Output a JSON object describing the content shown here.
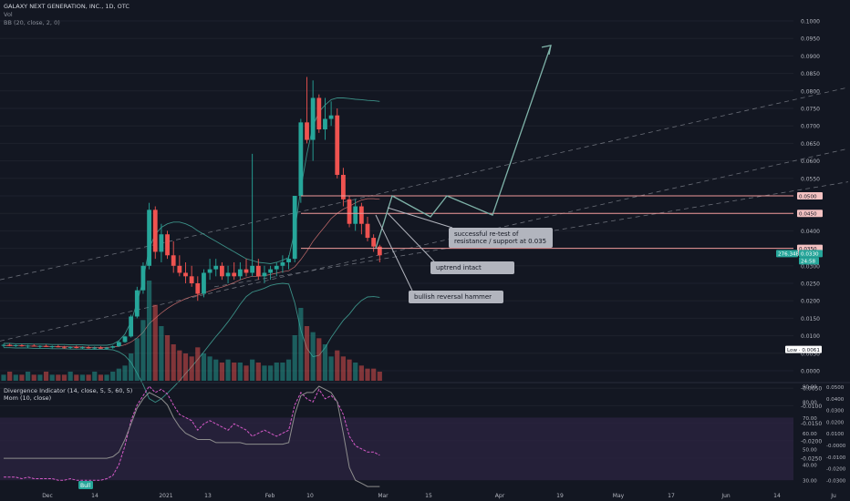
{
  "header": {
    "title": "GALAXY NEXT GENERATION, INC., 1D, OTC",
    "vol_label": "Vol",
    "bb_label": "BB (20, close, 2, 0)",
    "div_label": "Divergence Indicator (14, close, 5, 5, 60, 5)",
    "mom_label": "Mom (10, close)"
  },
  "colors": {
    "background": "#131722",
    "up": "#26a69a",
    "down": "#ef5350",
    "grid": "#1e222d",
    "text": "#b2b5be",
    "hline": "#ef9a9a",
    "projection": "#7fb3a9",
    "rsi_band": "#2b2340",
    "rsi": "#d459c7",
    "mom": "#8d8d8d",
    "label_bg": "#b2b5be"
  },
  "chart_data": {
    "type": "candlestick",
    "title": "GALAXY NEXT GENERATION, INC., 1D, OTC",
    "y_ticks": [
      "0.1000",
      "0.0950",
      "0.0900",
      "0.0850",
      "0.0800",
      "0.0750",
      "0.0700",
      "0.0650",
      "0.0600",
      "0.0550",
      "0.0500",
      "0.0450",
      "0.0400",
      "0.0350",
      "0.0300",
      "0.0250",
      "0.0200",
      "0.0150",
      "0.0100",
      "0.0050",
      "0.0000",
      "-0.0050",
      "-0.0100",
      "-0.0150",
      "-0.0200",
      "-0.0250"
    ],
    "x_ticks": [
      "Dec",
      "14",
      "2021",
      "13",
      "Feb",
      "10",
      "Mar",
      "15",
      "Apr",
      "19",
      "May",
      "17",
      "Jun",
      "14",
      "Ju"
    ],
    "price_labels": {
      "r050": "0.0500",
      "r045": "0.0450",
      "r035": "0.0350",
      "vol": "276.34B",
      "last": "0.0330",
      "countdown": "24:58",
      "low": "Low · 0.0061"
    },
    "candles": [
      [
        0.0072,
        0.0077,
        0.0067,
        0.0074
      ],
      [
        0.0074,
        0.0078,
        0.007,
        0.0071
      ],
      [
        0.0071,
        0.0075,
        0.0068,
        0.0073
      ],
      [
        0.0073,
        0.0076,
        0.0069,
        0.007
      ],
      [
        0.007,
        0.0074,
        0.0066,
        0.0072
      ],
      [
        0.0072,
        0.0076,
        0.0069,
        0.0069
      ],
      [
        0.0069,
        0.0073,
        0.0065,
        0.0071
      ],
      [
        0.0071,
        0.0075,
        0.0068,
        0.0068
      ],
      [
        0.0068,
        0.0072,
        0.0064,
        0.007
      ],
      [
        0.007,
        0.0074,
        0.0067,
        0.0067
      ],
      [
        0.0067,
        0.0071,
        0.0063,
        0.0066
      ],
      [
        0.0066,
        0.007,
        0.0062,
        0.0068
      ],
      [
        0.0068,
        0.0072,
        0.0064,
        0.0065
      ],
      [
        0.0065,
        0.007,
        0.0062,
        0.0067
      ],
      [
        0.0067,
        0.0071,
        0.0063,
        0.0064
      ],
      [
        0.0064,
        0.0069,
        0.0061,
        0.0066
      ],
      [
        0.0066,
        0.007,
        0.0063,
        0.0063
      ],
      [
        0.0063,
        0.0068,
        0.0061,
        0.0066
      ],
      [
        0.0066,
        0.0072,
        0.0063,
        0.007
      ],
      [
        0.007,
        0.0085,
        0.0068,
        0.0082
      ],
      [
        0.0082,
        0.01,
        0.008,
        0.0098
      ],
      [
        0.0098,
        0.016,
        0.0095,
        0.0155
      ],
      [
        0.0155,
        0.024,
        0.015,
        0.023
      ],
      [
        0.023,
        0.031,
        0.022,
        0.03
      ],
      [
        0.03,
        0.048,
        0.029,
        0.046
      ],
      [
        0.046,
        0.047,
        0.032,
        0.034
      ],
      [
        0.034,
        0.042,
        0.031,
        0.039
      ],
      [
        0.039,
        0.04,
        0.032,
        0.033
      ],
      [
        0.033,
        0.037,
        0.028,
        0.03
      ],
      [
        0.03,
        0.033,
        0.027,
        0.028
      ],
      [
        0.028,
        0.031,
        0.025,
        0.027
      ],
      [
        0.027,
        0.03,
        0.024,
        0.025
      ],
      [
        0.025,
        0.027,
        0.02,
        0.022
      ],
      [
        0.022,
        0.029,
        0.021,
        0.028
      ],
      [
        0.028,
        0.032,
        0.026,
        0.029
      ],
      [
        0.029,
        0.032,
        0.027,
        0.03
      ],
      [
        0.03,
        0.031,
        0.026,
        0.027
      ],
      [
        0.027,
        0.03,
        0.025,
        0.028
      ],
      [
        0.028,
        0.031,
        0.026,
        0.027
      ],
      [
        0.027,
        0.031,
        0.026,
        0.029
      ],
      [
        0.029,
        0.032,
        0.027,
        0.028
      ],
      [
        0.028,
        0.062,
        0.027,
        0.03
      ],
      [
        0.03,
        0.032,
        0.026,
        0.027
      ],
      [
        0.027,
        0.03,
        0.025,
        0.028
      ],
      [
        0.028,
        0.03,
        0.026,
        0.029
      ],
      [
        0.029,
        0.031,
        0.027,
        0.03
      ],
      [
        0.03,
        0.033,
        0.028,
        0.031
      ],
      [
        0.031,
        0.033,
        0.029,
        0.032
      ],
      [
        0.032,
        0.05,
        0.031,
        0.05
      ],
      [
        0.05,
        0.072,
        0.048,
        0.071
      ],
      [
        0.071,
        0.084,
        0.065,
        0.066
      ],
      [
        0.066,
        0.083,
        0.06,
        0.078
      ],
      [
        0.078,
        0.079,
        0.068,
        0.069
      ],
      [
        0.069,
        0.078,
        0.066,
        0.072
      ],
      [
        0.072,
        0.077,
        0.07,
        0.073
      ],
      [
        0.073,
        0.075,
        0.055,
        0.056
      ],
      [
        0.056,
        0.058,
        0.047,
        0.049
      ],
      [
        0.049,
        0.05,
        0.041,
        0.042
      ],
      [
        0.042,
        0.049,
        0.04,
        0.047
      ],
      [
        0.047,
        0.048,
        0.039,
        0.042
      ],
      [
        0.042,
        0.044,
        0.037,
        0.038
      ],
      [
        0.038,
        0.039,
        0.034,
        0.0355
      ],
      [
        0.0355,
        0.036,
        0.031,
        0.033
      ]
    ],
    "volumes": [
      2,
      3,
      2,
      2,
      3,
      2,
      2,
      3,
      2,
      2,
      2,
      3,
      2,
      2,
      2,
      3,
      2,
      2,
      3,
      4,
      5,
      9,
      14,
      20,
      33,
      25,
      18,
      15,
      12,
      10,
      9,
      8,
      11,
      9,
      8,
      7,
      6,
      7,
      6,
      6,
      5,
      7,
      6,
      5,
      5,
      6,
      6,
      7,
      15,
      24,
      18,
      16,
      14,
      12,
      8,
      10,
      8,
      7,
      6,
      5,
      4,
      4,
      3
    ],
    "bb_mid": [
      0.0072,
      0.0072,
      0.0071,
      0.0071,
      0.0071,
      0.007,
      0.007,
      0.007,
      0.0069,
      0.0069,
      0.0069,
      0.0068,
      0.0068,
      0.0068,
      0.0067,
      0.0067,
      0.0067,
      0.0067,
      0.0068,
      0.007,
      0.0074,
      0.0082,
      0.0094,
      0.011,
      0.0135,
      0.015,
      0.0165,
      0.0178,
      0.0189,
      0.0198,
      0.0206,
      0.0212,
      0.0216,
      0.0222,
      0.0228,
      0.0234,
      0.0239,
      0.0245,
      0.0252,
      0.026,
      0.0266,
      0.027,
      0.027,
      0.0272,
      0.0275,
      0.0279,
      0.0283,
      0.0286,
      0.0297,
      0.0318,
      0.0342,
      0.037,
      0.0392,
      0.0413,
      0.0435,
      0.045,
      0.0462,
      0.047,
      0.048,
      0.0488,
      0.0492,
      0.0492,
      0.049
    ],
    "bb_upper": [
      0.0078,
      0.0078,
      0.0077,
      0.0077,
      0.0077,
      0.0076,
      0.0076,
      0.0076,
      0.0075,
      0.0075,
      0.0075,
      0.0074,
      0.0074,
      0.0074,
      0.0073,
      0.0073,
      0.0073,
      0.0073,
      0.0076,
      0.0086,
      0.0105,
      0.014,
      0.0195,
      0.026,
      0.035,
      0.039,
      0.041,
      0.042,
      0.0425,
      0.0425,
      0.042,
      0.0412,
      0.04,
      0.039,
      0.038,
      0.037,
      0.036,
      0.035,
      0.034,
      0.033,
      0.032,
      0.0315,
      0.031,
      0.0308,
      0.0306,
      0.031,
      0.0316,
      0.0324,
      0.04,
      0.052,
      0.062,
      0.07,
      0.074,
      0.076,
      0.0775,
      0.078,
      0.078,
      0.0778,
      0.0776,
      0.0775,
      0.0773,
      0.0772,
      0.077
    ],
    "bb_lower": [
      0.0066,
      0.0066,
      0.0065,
      0.0065,
      0.0065,
      0.0064,
      0.0064,
      0.0064,
      0.0063,
      0.0063,
      0.0063,
      0.0062,
      0.0062,
      0.0062,
      0.0061,
      0.0061,
      0.0061,
      0.0061,
      0.006,
      0.0054,
      0.0043,
      0.0024,
      -0.0007,
      -0.004,
      -0.008,
      -0.009,
      -0.008,
      -0.0064,
      -0.0047,
      -0.0029,
      -0.0008,
      0.0012,
      0.0032,
      0.0054,
      0.0076,
      0.0098,
      0.0118,
      0.014,
      0.0164,
      0.019,
      0.0212,
      0.0225,
      0.023,
      0.0236,
      0.0244,
      0.0248,
      0.025,
      0.0248,
      0.0194,
      0.0116,
      0.0064,
      0.004,
      0.0044,
      0.0066,
      0.0095,
      0.012,
      0.0144,
      0.0162,
      0.0184,
      0.0201,
      0.0211,
      0.0212,
      0.021
    ],
    "rsi": [
      32,
      32,
      32,
      31,
      32,
      31,
      31,
      31,
      31,
      30,
      30,
      31,
      30,
      30,
      30,
      30,
      30,
      31,
      33,
      40,
      52,
      68,
      78,
      84,
      90,
      86,
      88,
      85,
      78,
      72,
      70,
      68,
      62,
      66,
      68,
      66,
      64,
      62,
      66,
      64,
      62,
      58,
      60,
      62,
      60,
      58,
      60,
      62,
      78,
      86,
      82,
      80,
      88,
      82,
      84,
      80,
      72,
      58,
      52,
      50,
      48,
      48,
      46
    ],
    "mom": [
      44,
      44,
      44,
      44,
      44,
      44,
      44,
      44,
      44,
      44,
      44,
      44,
      44,
      44,
      44,
      44,
      44,
      44,
      45,
      48,
      56,
      66,
      76,
      82,
      86,
      84,
      82,
      78,
      70,
      64,
      60,
      58,
      56,
      56,
      56,
      54,
      54,
      54,
      54,
      54,
      53,
      53,
      53,
      53,
      53,
      53,
      53,
      54,
      72,
      84,
      86,
      86,
      90,
      88,
      86,
      80,
      60,
      38,
      30,
      28,
      26,
      26,
      26
    ],
    "rsi_ticks": [
      "90.00",
      "80.00",
      "70.00",
      "60.00",
      "50.00",
      "40.00",
      "30.00"
    ],
    "mom_ticks": [
      "0.0500",
      "0.0400",
      "0.0300",
      "0.0200",
      "0.0100",
      "-0.0000",
      "-0.0100",
      "-0.0200",
      "-0.0300"
    ]
  },
  "annotations": {
    "retest": "successful re-test of resistance / support at 0.035",
    "uptrend": "uptrend intact",
    "hammer": "bullish reversal hammer",
    "bull": "Bull"
  }
}
